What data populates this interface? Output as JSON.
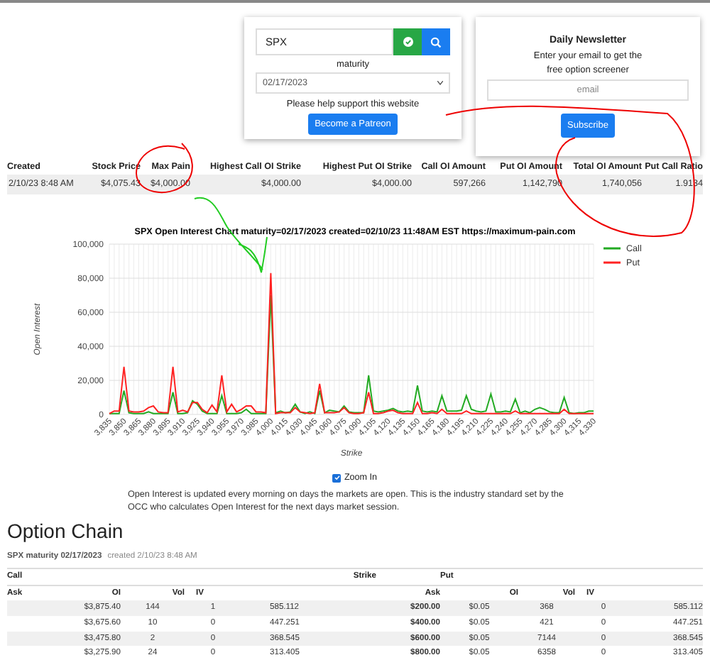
{
  "search": {
    "value": "SPX",
    "maturity_label": "maturity",
    "maturity": "02/17/2023",
    "support_text": "Please help support this website",
    "patreon_button": "Become a Patreon"
  },
  "newsletter": {
    "title": "Daily Newsletter",
    "text": "Enter your email to get the free option screener",
    "email_placeholder": "email",
    "button": "Subscribe"
  },
  "summary": {
    "columns": [
      "Created",
      "Stock Price",
      "Max Pain",
      "Highest Call OI Strike",
      "Highest Put OI Strike",
      "Call OI Amount",
      "Put OI Amount",
      "Total OI Amount",
      "Put Call Ratio"
    ],
    "row": [
      "2/10/23 8:48 AM",
      "$4,075.43",
      "$4,000.00",
      "$4,000.00",
      "$4,000.00",
      "597,266",
      "1,142,790",
      "1,740,056",
      "1.9134"
    ]
  },
  "chart": {
    "chart_data": {
      "type": "line",
      "title": "SPX Open Interest Chart maturity=02/17/2023 created=02/10/23 11:48AM EST https://maximum-pain.com",
      "xlabel": "Strike",
      "ylabel": "Open Interest",
      "x": [
        3835,
        3840,
        3845,
        3850,
        3855,
        3860,
        3865,
        3870,
        3875,
        3880,
        3885,
        3890,
        3895,
        3900,
        3905,
        3910,
        3915,
        3920,
        3925,
        3930,
        3935,
        3940,
        3945,
        3950,
        3955,
        3960,
        3965,
        3970,
        3975,
        3980,
        3985,
        3990,
        3995,
        4000,
        4005,
        4010,
        4015,
        4020,
        4025,
        4030,
        4035,
        4040,
        4045,
        4050,
        4055,
        4060,
        4065,
        4070,
        4075,
        4080,
        4085,
        4090,
        4095,
        4100,
        4105,
        4110,
        4115,
        4120,
        4125,
        4130,
        4135,
        4140,
        4145,
        4150,
        4155,
        4160,
        4165,
        4170,
        4175,
        4180,
        4185,
        4190,
        4195,
        4200,
        4205,
        4210,
        4215,
        4220,
        4225,
        4230,
        4235,
        4240,
        4245,
        4250,
        4255,
        4260,
        4265,
        4270,
        4275,
        4280,
        4285,
        4290,
        4295,
        4300,
        4305,
        4310,
        4315,
        4320,
        4325,
        4330
      ],
      "series": [
        {
          "name": "Call",
          "color": "#22aa22",
          "values": [
            500,
            500,
            500,
            14000,
            1000,
            500,
            500,
            500,
            1500,
            500,
            500,
            500,
            500,
            13000,
            500,
            500,
            1000,
            8000,
            6000,
            2000,
            500,
            500,
            500,
            11000,
            500,
            500,
            500,
            1000,
            3000,
            500,
            500,
            500,
            500,
            70000,
            1000,
            2000,
            1000,
            1500,
            6000,
            1500,
            500,
            1500,
            500,
            14000,
            1000,
            2500,
            2000,
            1500,
            5000,
            1500,
            1000,
            1000,
            1000,
            23000,
            2000,
            1500,
            2000,
            2500,
            3500,
            2000,
            1500,
            2000,
            1500,
            17000,
            2000,
            1500,
            2000,
            1500,
            11000,
            2000,
            2000,
            2000,
            2500,
            11000,
            3000,
            2000,
            1500,
            2000,
            12000,
            1500,
            1500,
            2000,
            1500,
            9000,
            1000,
            2000,
            1000,
            3000,
            4000,
            3000,
            1500,
            1000,
            1000,
            10000,
            1000,
            500,
            1000,
            1000,
            2000,
            2000
          ]
        },
        {
          "name": "Put",
          "color": "#ff2222",
          "values": [
            500,
            2000,
            2000,
            28000,
            2000,
            1500,
            1500,
            2000,
            4000,
            5000,
            1500,
            1000,
            1000,
            28000,
            1500,
            2500,
            1500,
            7000,
            7000,
            3000,
            1000,
            5500,
            1500,
            23000,
            1500,
            6000,
            1500,
            3000,
            5000,
            5000,
            1500,
            1500,
            1000,
            83000,
            500,
            1000,
            1000,
            1000,
            4000,
            1500,
            1000,
            500,
            1000,
            18000,
            1000,
            1000,
            1000,
            1500,
            4000,
            1000,
            500,
            500,
            1000,
            13000,
            500,
            500,
            1000,
            2000,
            2500,
            1000,
            500,
            500,
            500,
            7000,
            500,
            500,
            1000,
            500,
            3000,
            500,
            500,
            500,
            500,
            2000,
            500,
            500,
            500,
            500,
            500,
            500,
            500,
            500,
            500,
            2000,
            500,
            500,
            500,
            500,
            500,
            500,
            500,
            500,
            500,
            3000,
            500,
            500,
            500,
            500,
            500,
            500
          ]
        }
      ],
      "xticks": [
        {
          "value": 3835,
          "label": "3,835"
        },
        {
          "value": 3850,
          "label": "3,850"
        },
        {
          "value": 3865,
          "label": "3,865"
        },
        {
          "value": 3880,
          "label": "3,880"
        },
        {
          "value": 3895,
          "label": "3,895"
        },
        {
          "value": 3910,
          "label": "3,910"
        },
        {
          "value": 3925,
          "label": "3,925"
        },
        {
          "value": 3940,
          "label": "3,940"
        },
        {
          "value": 3955,
          "label": "3,955"
        },
        {
          "value": 3970,
          "label": "3,970"
        },
        {
          "value": 3985,
          "label": "3,985"
        },
        {
          "value": 4000,
          "label": "4,000"
        },
        {
          "value": 4015,
          "label": "4,015"
        },
        {
          "value": 4030,
          "label": "4,030"
        },
        {
          "value": 4045,
          "label": "4,045"
        },
        {
          "value": 4060,
          "label": "4,060"
        },
        {
          "value": 4075,
          "label": "4,075"
        },
        {
          "value": 4090,
          "label": "4,090"
        },
        {
          "value": 4105,
          "label": "4,105"
        },
        {
          "value": 4120,
          "label": "4,120"
        },
        {
          "value": 4135,
          "label": "4,135"
        },
        {
          "value": 4150,
          "label": "4,150"
        },
        {
          "value": 4165,
          "label": "4,165"
        },
        {
          "value": 4180,
          "label": "4,180"
        },
        {
          "value": 4195,
          "label": "4,195"
        },
        {
          "value": 4210,
          "label": "4,210"
        },
        {
          "value": 4225,
          "label": "4,225"
        },
        {
          "value": 4240,
          "label": "4,240"
        },
        {
          "value": 4255,
          "label": "4,255"
        },
        {
          "value": 4270,
          "label": "4,270"
        },
        {
          "value": 4285,
          "label": "4,285"
        },
        {
          "value": 4300,
          "label": "4,300"
        },
        {
          "value": 4315,
          "label": "4,315"
        },
        {
          "value": 4330,
          "label": "4,330"
        }
      ],
      "xlim": [
        3835,
        4330
      ],
      "grid": true,
      "legend": "right",
      "ylim": [
        0,
        100000
      ],
      "yticks": [
        {
          "value": 0,
          "label": "0"
        },
        {
          "value": 20000,
          "label": "20,000"
        },
        {
          "value": 40000,
          "label": "40,000"
        },
        {
          "value": 60000,
          "label": "60,000"
        },
        {
          "value": 80000,
          "label": "80,000"
        },
        {
          "value": 100000,
          "label": "100,000"
        }
      ]
    },
    "zoom": {
      "label": "Zoom In",
      "checked": true
    }
  },
  "note": "Open Interest is updated every morning on days the markets are open. This is the industry standard set by the OCC who calculates Open Interest for the next days market session.",
  "option_chain": {
    "heading": "Option Chain",
    "subtitle": "SPX maturity 02/17/2023",
    "created": "created 2/10/23 8:48 AM",
    "call_header": "Call",
    "strike_header": "Strike",
    "put_header": "Put",
    "call_columns": [
      "Ask",
      "OI",
      "Vol",
      "IV"
    ],
    "put_columns": [
      "Ask",
      "OI",
      "Vol",
      "IV"
    ],
    "rows": [
      {
        "call": [
          "$3,875.40",
          "144",
          "1",
          "585.112"
        ],
        "strike": "$200.00",
        "put": [
          "$0.05",
          "368",
          "0",
          "585.112"
        ]
      },
      {
        "call": [
          "$3,675.60",
          "10",
          "0",
          "447.251"
        ],
        "strike": "$400.00",
        "put": [
          "$0.05",
          "421",
          "0",
          "447.251"
        ]
      },
      {
        "call": [
          "$3,475.80",
          "2",
          "0",
          "368.545"
        ],
        "strike": "$600.00",
        "put": [
          "$0.05",
          "7144",
          "0",
          "368.545"
        ]
      },
      {
        "call": [
          "$3,275.90",
          "24",
          "0",
          "313.405"
        ],
        "strike": "$800.00",
        "put": [
          "$0.05",
          "6358",
          "0",
          "313.405"
        ]
      }
    ]
  }
}
